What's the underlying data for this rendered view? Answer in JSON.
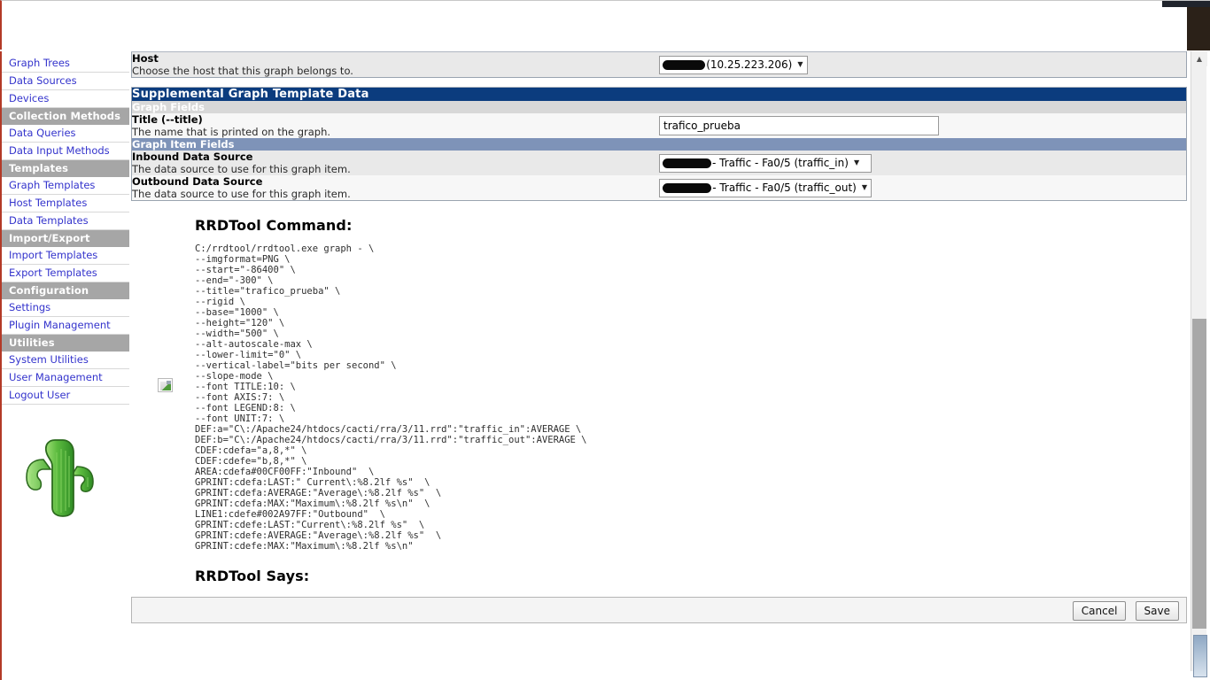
{
  "sidebar": {
    "items": [
      {
        "label": "Graph Trees",
        "type": "link",
        "name": "sidebar-item-graph-trees"
      },
      {
        "label": "Data Sources",
        "type": "link",
        "name": "sidebar-item-data-sources"
      },
      {
        "label": "Devices",
        "type": "link",
        "name": "sidebar-item-devices"
      },
      {
        "label": "Collection Methods",
        "type": "header",
        "name": "sidebar-header-collection-methods"
      },
      {
        "label": "Data Queries",
        "type": "link",
        "name": "sidebar-item-data-queries"
      },
      {
        "label": "Data Input Methods",
        "type": "link",
        "name": "sidebar-item-data-input-methods"
      },
      {
        "label": "Templates",
        "type": "header",
        "name": "sidebar-header-templates"
      },
      {
        "label": "Graph Templates",
        "type": "link",
        "name": "sidebar-item-graph-templates"
      },
      {
        "label": "Host Templates",
        "type": "link",
        "name": "sidebar-item-host-templates"
      },
      {
        "label": "Data Templates",
        "type": "link",
        "name": "sidebar-item-data-templates"
      },
      {
        "label": "Import/Export",
        "type": "header",
        "name": "sidebar-header-import-export"
      },
      {
        "label": "Import Templates",
        "type": "link",
        "name": "sidebar-item-import-templates"
      },
      {
        "label": "Export Templates",
        "type": "link",
        "name": "sidebar-item-export-templates"
      },
      {
        "label": "Configuration",
        "type": "header",
        "name": "sidebar-header-configuration"
      },
      {
        "label": "Settings",
        "type": "link",
        "name": "sidebar-item-settings"
      },
      {
        "label": "Plugin Management",
        "type": "link",
        "name": "sidebar-item-plugin-management"
      },
      {
        "label": "Utilities",
        "type": "header",
        "name": "sidebar-header-utilities"
      },
      {
        "label": "System Utilities",
        "type": "link",
        "name": "sidebar-item-system-utilities"
      },
      {
        "label": "User Management",
        "type": "link",
        "name": "sidebar-item-user-management"
      },
      {
        "label": "Logout User",
        "type": "link",
        "name": "sidebar-item-logout-user"
      }
    ],
    "logo_alt": "cactus-logo"
  },
  "host_field": {
    "label": "Host",
    "description": "Choose the host that this graph belongs to.",
    "selected_value": "(10.25.223.206)",
    "redacted": true
  },
  "section": {
    "main_header": "Supplemental Graph Template Data",
    "graph_fields_header": "Graph Fields",
    "graph_item_fields_header": "Graph Item Fields"
  },
  "title_field": {
    "label": "Title (--title)",
    "description": "The name that is printed on the graph.",
    "value": "trafico_prueba",
    "placeholder": ""
  },
  "inbound_field": {
    "label": "Inbound Data Source",
    "description": "The data source to use for this graph item.",
    "selected_value": "- Traffic - Fa0/5 (traffic_in)",
    "redacted": true
  },
  "outbound_field": {
    "label": "Outbound Data Source",
    "description": "The data source to use for this graph item.",
    "selected_value": "- Traffic - Fa0/5 (traffic_out)",
    "redacted": true
  },
  "rrdtool": {
    "command_heading": "RRDTool Command:",
    "says_heading": "RRDTool Says:",
    "says_output": "",
    "command": "C:/rrdtool/rrdtool.exe graph - \\\n--imgformat=PNG \\\n--start=\"-86400\" \\\n--end=\"-300\" \\\n--title=\"trafico_prueba\" \\\n--rigid \\\n--base=\"1000\" \\\n--height=\"120\" \\\n--width=\"500\" \\\n--alt-autoscale-max \\\n--lower-limit=\"0\" \\\n--vertical-label=\"bits per second\" \\\n--slope-mode \\\n--font TITLE:10: \\\n--font AXIS:7: \\\n--font LEGEND:8: \\\n--font UNIT:7: \\\nDEF:a=\"C\\:/Apache24/htdocs/cacti/rra/3/11.rrd\":\"traffic_in\":AVERAGE \\\nDEF:b=\"C\\:/Apache24/htdocs/cacti/rra/3/11.rrd\":\"traffic_out\":AVERAGE \\\nCDEF:cdefa=\"a,8,*\" \\\nCDEF:cdefe=\"b,8,*\" \\\nAREA:cdefa#00CF00FF:\"Inbound\"  \\\nGPRINT:cdefa:LAST:\" Current\\:%8.2lf %s\"  \\\nGPRINT:cdefa:AVERAGE:\"Average\\:%8.2lf %s\"  \\\nGPRINT:cdefa:MAX:\"Maximum\\:%8.2lf %s\\n\"  \\\nLINE1:cdefe#002A97FF:\"Outbound\"  \\\nGPRINT:cdefe:LAST:\"Current\\:%8.2lf %s\"  \\\nGPRINT:cdefe:AVERAGE:\"Average\\:%8.2lf %s\"  \\\nGPRINT:cdefe:MAX:\"Maximum\\:%8.2lf %s\\n\""
  },
  "buttons": {
    "cancel": "Cancel",
    "save": "Save"
  },
  "colors": {
    "header_navy": "#0b3c7e",
    "subheader_blue": "#7e93b8",
    "subheader_gray": "#d8d8d8",
    "sidebar_header_gray": "#a6a6a6",
    "link_blue": "#3333cc",
    "accent_red": "#b33a27"
  }
}
